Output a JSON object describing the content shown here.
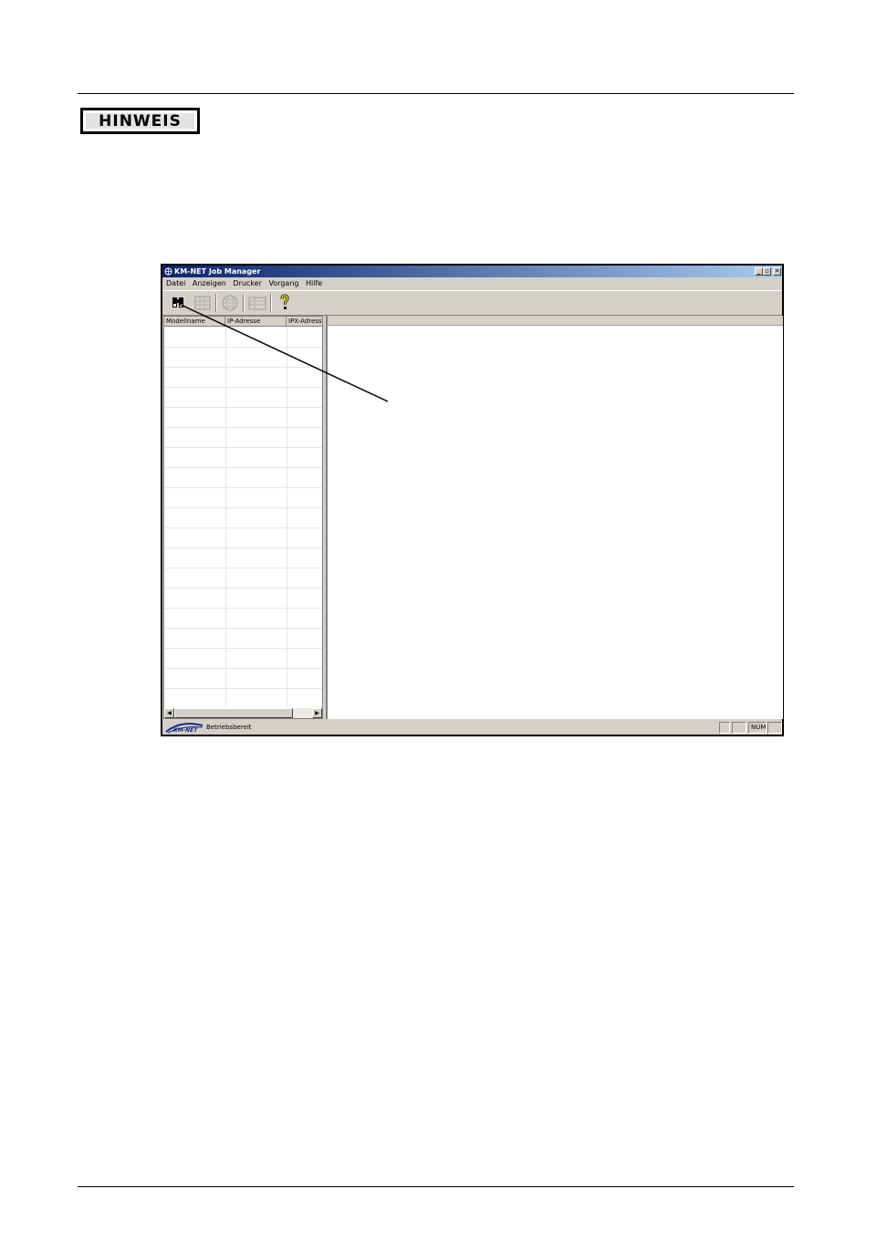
{
  "notice": {
    "label": "HINWEIS"
  },
  "window": {
    "title": "KM-NET Job Manager",
    "controls": {
      "minimize": "_",
      "restore": "▫",
      "close": "✕"
    }
  },
  "menu": {
    "items": [
      "Datei",
      "Anzeigen",
      "Drucker",
      "Vorgang",
      "Hilfe"
    ]
  },
  "toolbar": {
    "buttons": [
      "search-printer",
      "printer-status",
      "printer-network",
      "job-list",
      "help"
    ]
  },
  "table": {
    "columns": [
      "Modellname",
      "IP-Adresse",
      "IPX-Adresse"
    ]
  },
  "status": {
    "logo": "KM-NET",
    "text": "Betriebsbereit",
    "indicator": "NUM"
  },
  "colors": {
    "titlebar_start": "#0a246a",
    "titlebar_end": "#a6caf0",
    "chrome": "#d4d0c8",
    "help_icon": "#f5e000"
  }
}
